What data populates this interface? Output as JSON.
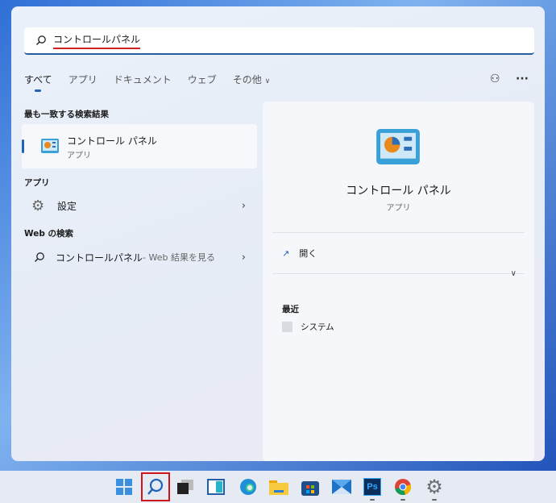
{
  "search": {
    "query": "コントロールパネル"
  },
  "tabs": [
    {
      "label": "すべて"
    },
    {
      "label": "アプリ"
    },
    {
      "label": "ドキュメント"
    },
    {
      "label": "ウェブ"
    },
    {
      "label": "その他"
    }
  ],
  "left": {
    "best_match_heading": "最も一致する検索結果",
    "best_match": {
      "title": "コントロール パネル",
      "subtitle": "アプリ"
    },
    "apps_heading": "アプリ",
    "apps": [
      {
        "label": "設定"
      }
    ],
    "web_heading": "Web の検索",
    "web": {
      "label": "コントロールパネル",
      "suffix": " - Web 結果を見る"
    }
  },
  "right": {
    "title": "コントロール パネル",
    "subtitle": "アプリ",
    "open_label": "開く",
    "recent_heading": "最近",
    "recent": [
      {
        "label": "システム"
      }
    ]
  },
  "taskbar": [
    "start",
    "search",
    "task-view",
    "widgets",
    "edge",
    "explorer",
    "store",
    "mail",
    "photoshop",
    "chrome",
    "settings"
  ],
  "colors": {
    "accent": "#1e63b8",
    "highlight": "#d02020"
  }
}
